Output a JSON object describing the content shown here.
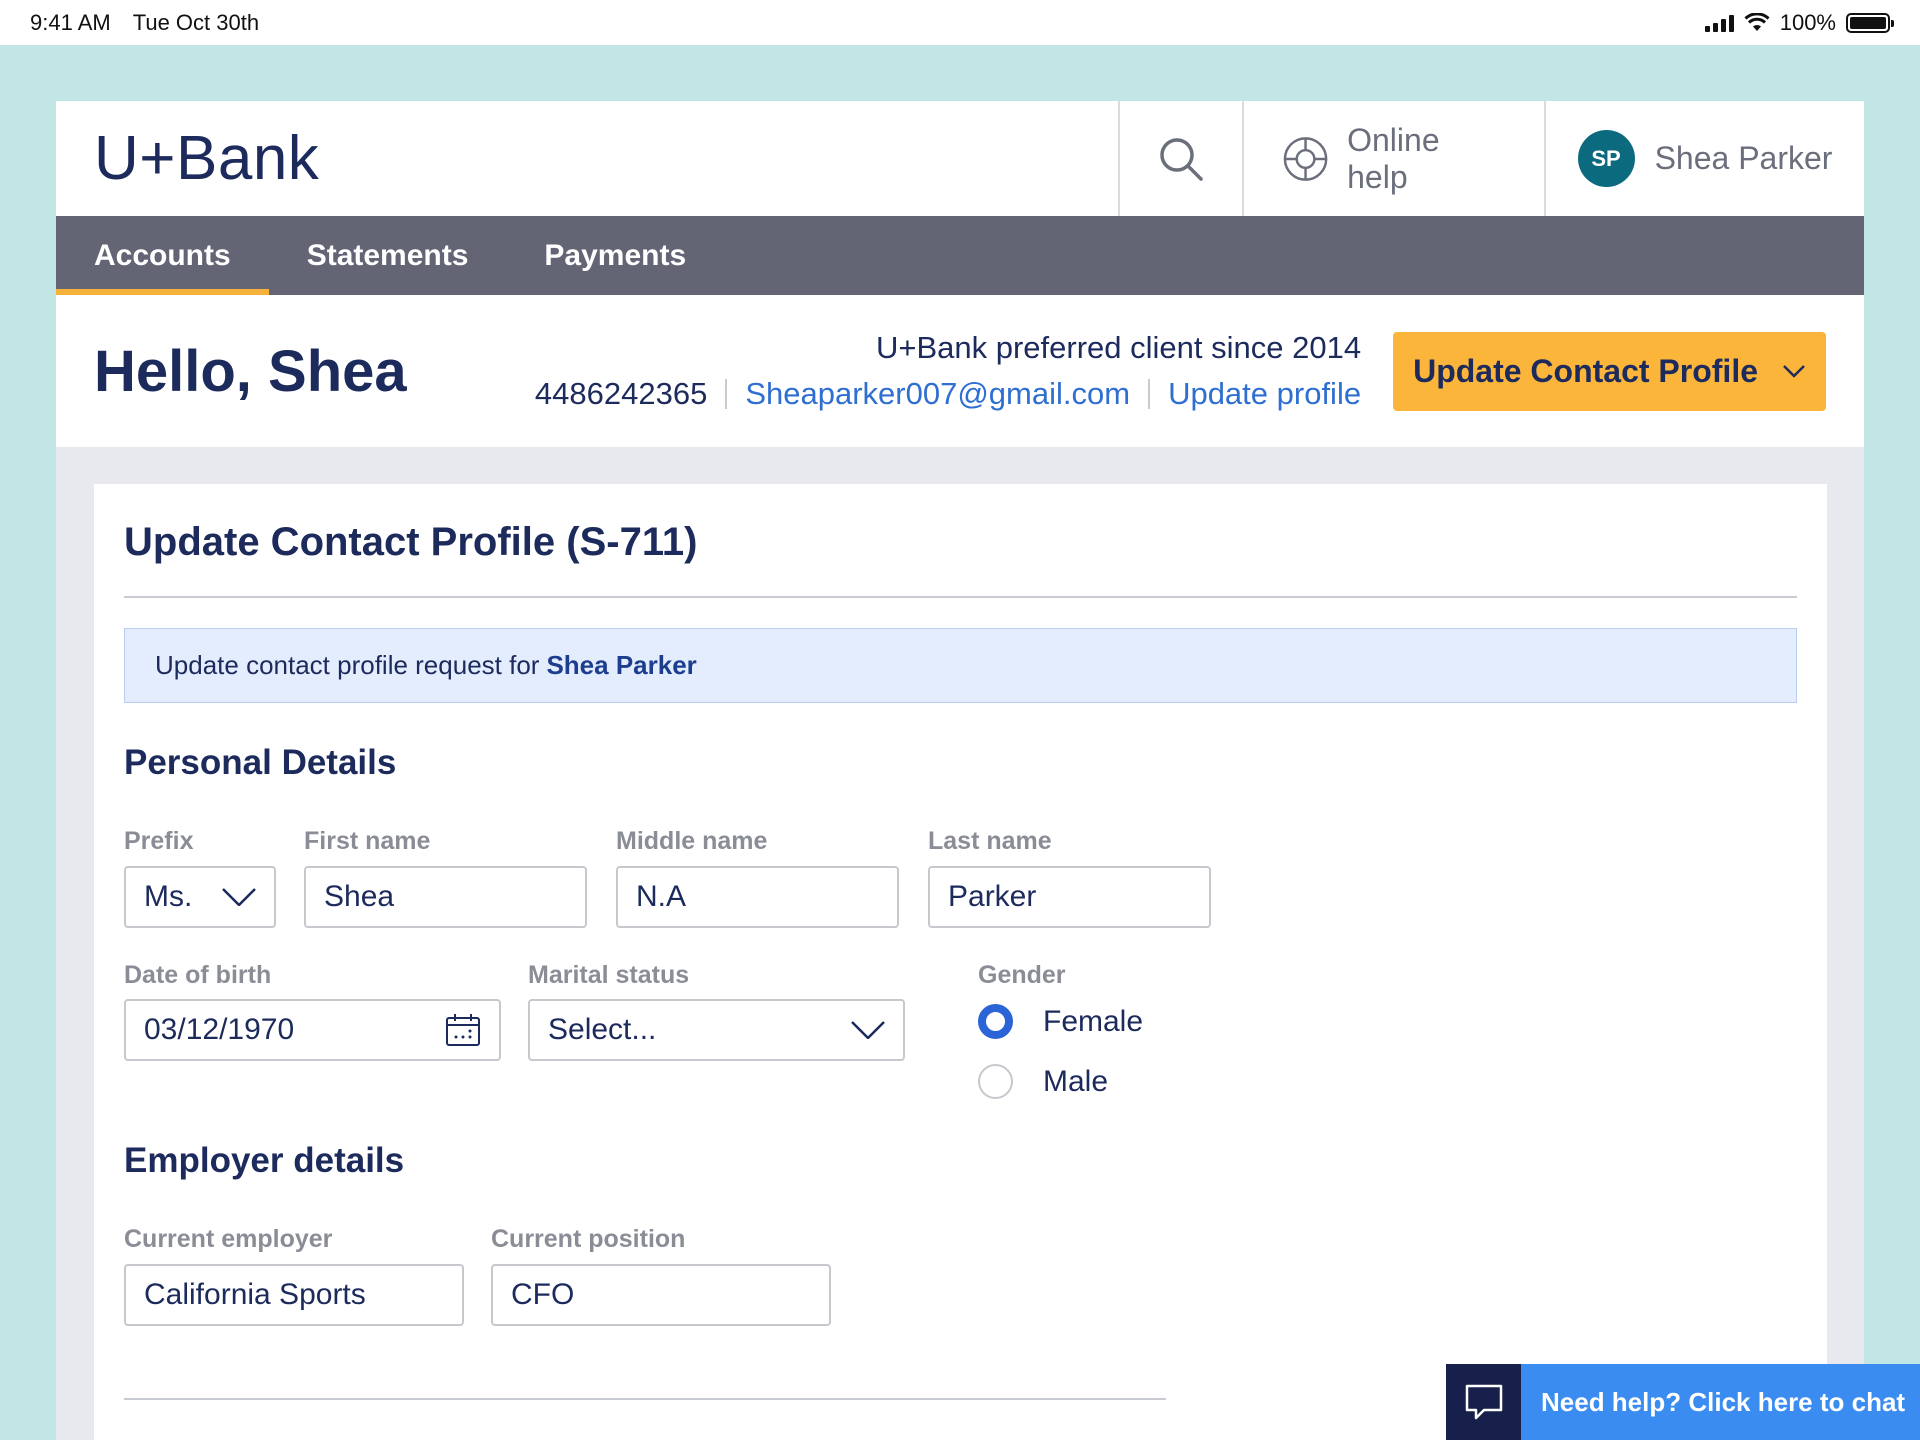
{
  "status_bar": {
    "time": "9:41 AM",
    "date": "Tue Oct 30th",
    "battery": "100%"
  },
  "header": {
    "logo": "U+Bank",
    "online_help": "Online help",
    "user_initials": "SP",
    "user_name": "Shea Parker"
  },
  "nav": {
    "items": [
      {
        "label": "Accounts",
        "active": true
      },
      {
        "label": "Statements",
        "active": false
      },
      {
        "label": "Payments",
        "active": false
      }
    ]
  },
  "hello_bar": {
    "greeting": "Hello, Shea",
    "client_since": "U+Bank preferred client since 2014",
    "phone": "4486242365",
    "email": "Sheaparker007@gmail.com",
    "update_profile_link": "Update profile",
    "action_button": "Update Contact Profile"
  },
  "form": {
    "title": "Update Contact Profile (S-711)",
    "banner_prefix": "Update contact profile request for",
    "banner_name": "Shea Parker",
    "personal_section": "Personal Details",
    "prefix": {
      "label": "Prefix",
      "value": "Ms."
    },
    "first_name": {
      "label": "First name",
      "value": "Shea"
    },
    "middle_name": {
      "label": "Middle name",
      "value": "N.A"
    },
    "last_name": {
      "label": "Last name",
      "value": "Parker"
    },
    "dob": {
      "label": "Date of birth",
      "value": "03/12/1970"
    },
    "marital": {
      "label": "Marital status",
      "value": "Select..."
    },
    "gender": {
      "label": "Gender",
      "options": [
        "Female",
        "Male"
      ],
      "selected": "Female"
    },
    "employer_section": "Employer details",
    "employer": {
      "label": "Current employer",
      "value": "California Sports"
    },
    "position": {
      "label": "Current position",
      "value": "CFO"
    }
  },
  "chat": {
    "label": "Need help? Click here to chat"
  },
  "colors": {
    "accent": "#fbb53a",
    "nav": "#636474",
    "brand": "#1c2a5c",
    "link": "#2f6fd1",
    "chat": "#3a8cf0"
  }
}
